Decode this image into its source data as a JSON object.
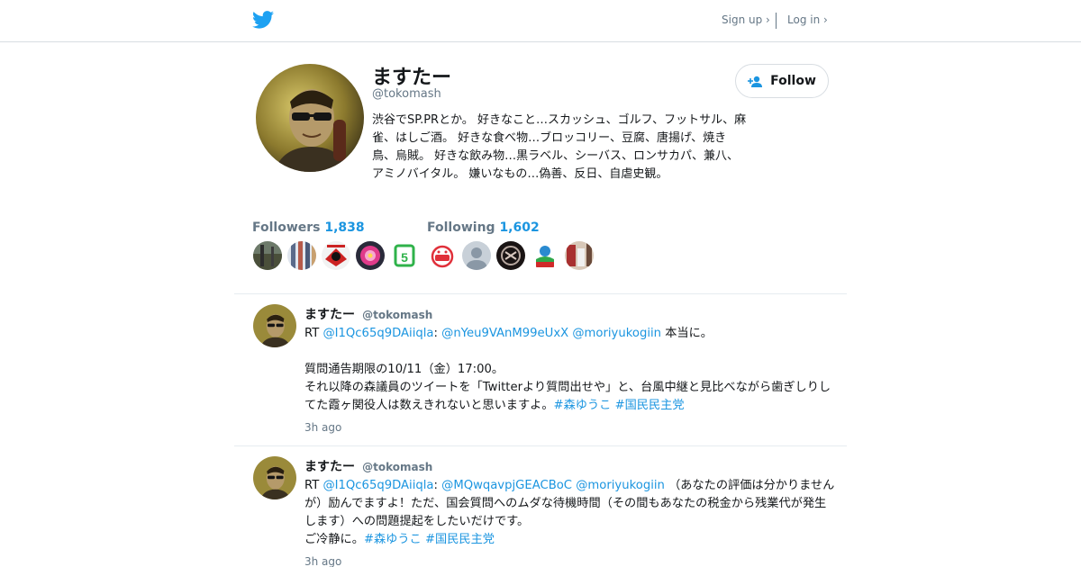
{
  "header": {
    "signup_label": "Sign up ›",
    "login_label": "Log in ›"
  },
  "profile": {
    "display_name": "ますたー",
    "handle": "@tokomash",
    "bio": "渋谷でSP.PRとか。 好きなこと…スカッシュ、ゴルフ、フットサル、麻雀、はしご酒。 好きな食べ物…ブロッコリー、豆腐、唐揚げ、焼き鳥、烏賊。 好きな飲み物…黒ラベル、シーバス、ロンサカパ、兼八、アミノバイタル。 嫌いなもの…偽善、反日、自虐史観。",
    "follow_label": "Follow",
    "followers_label": "Followers",
    "followers_count": "1,838",
    "following_label": "Following",
    "following_count": "1,602"
  },
  "tweets": [
    {
      "name": "ますたー",
      "handle": "@tokomash",
      "rt": "RT ",
      "mention1": "@I1Qc65q9DAiiqla",
      "colon": ": ",
      "mention2": "@nYeu9VAnM99eUxX",
      "space": " ",
      "mention3": "@moriyukogiin",
      "text1": " 本当に。\n\n質問通告期限の10/11（金）17:00。\nそれ以降の森議員のツイートを「Twitterより質問出せや」と、台風中継と見比べながら歯ぎしりしてた霞ヶ関役人は数えきれないと思いますよ。",
      "hashtag1": "#森ゆうこ",
      "hashtag2": "#国民民主党",
      "time": "3h ago"
    },
    {
      "name": "ますたー",
      "handle": "@tokomash",
      "rt": "RT ",
      "mention1": "@I1Qc65q9DAiiqla",
      "colon": ": ",
      "mention2": "@MQwqavpjGEACBoC",
      "space": " ",
      "mention3": "@moriyukogiin",
      "text1": " （あなたの評価は分かりませんが）励んでますよ！ただ、国会質問へのムダな待機時間（その間もあなたの税金から残業代が発生します）への問題提起をしたいだけです。\nご冷静に。",
      "hashtag1": "#森ゆうこ",
      "hashtag2": "#国民民主党",
      "time": "3h ago"
    }
  ],
  "colors": {
    "accent": "#1b95e0",
    "muted": "#657786",
    "text": "#14171a",
    "border": "#e6ecf0"
  },
  "icons": {
    "logo": "twitter-bird-icon",
    "follow": "add-user-icon"
  }
}
